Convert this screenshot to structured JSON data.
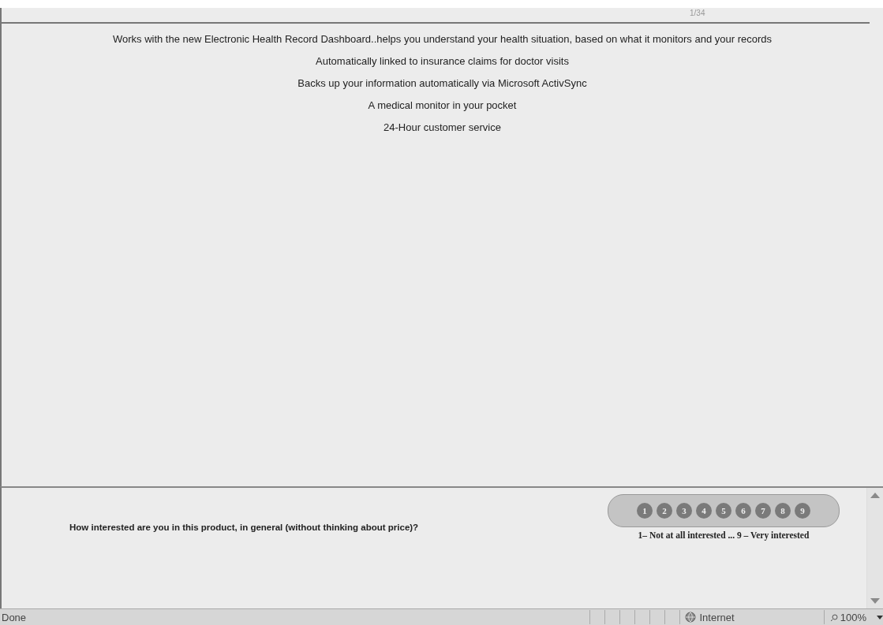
{
  "page_counter": "1/34",
  "features": [
    "Works with the new Electronic Health Record Dashboard..helps you understand your health situation, based on what it monitors and your records",
    "Automatically linked to insurance claims for doctor visits",
    "Backs up your information automatically via Microsoft ActivSync",
    "A medical monitor in your pocket",
    "24-Hour customer service"
  ],
  "question": {
    "text": "How interested are you in this product, in general (without thinking about price)?",
    "scale": [
      {
        "label": "1",
        "selected": false
      },
      {
        "label": "2",
        "selected": false
      },
      {
        "label": "3",
        "selected": false
      },
      {
        "label": "4",
        "selected": false
      },
      {
        "label": "5",
        "selected": false
      },
      {
        "label": "6",
        "selected": false
      },
      {
        "label": "7",
        "selected": false
      },
      {
        "label": "8",
        "selected": false
      },
      {
        "label": "9",
        "selected": false
      }
    ],
    "legend": "1– Not at all interested ... 9 – Very interested"
  },
  "status_bar": {
    "status": "Done",
    "zone": "Internet",
    "zoom": "100%"
  }
}
